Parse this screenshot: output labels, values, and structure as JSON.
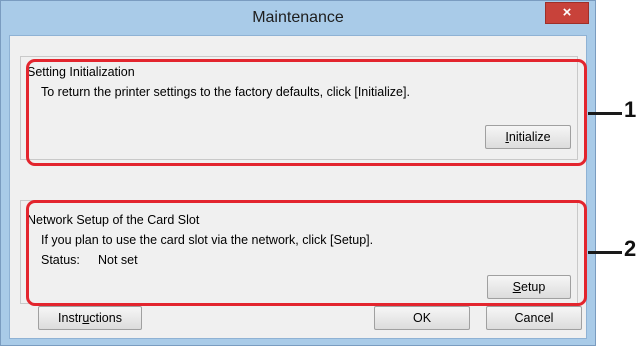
{
  "window": {
    "title": "Maintenance",
    "close_glyph": "×"
  },
  "setting_init": {
    "group_title": "Setting Initialization",
    "description": "To return the printer settings to the factory defaults, click [Initialize].",
    "button_accel": "I",
    "button_rest": "nitialize"
  },
  "network_setup": {
    "group_title": "Network Setup of the Card Slot",
    "description": "If you plan to use the card slot via the network, click [Setup].",
    "status_label": "Status:",
    "status_value": "Not set",
    "button_accel": "S",
    "button_rest": "etup"
  },
  "footer": {
    "instructions_pre": "Instr",
    "instructions_accel": "u",
    "instructions_post": "ctions",
    "ok_label": "OK",
    "cancel_label": "Cancel"
  },
  "callouts": [
    "1",
    "2"
  ],
  "colors": {
    "highlight": "#e3252e",
    "close_button": "#c8423a",
    "frame": "#a9cbe8"
  }
}
